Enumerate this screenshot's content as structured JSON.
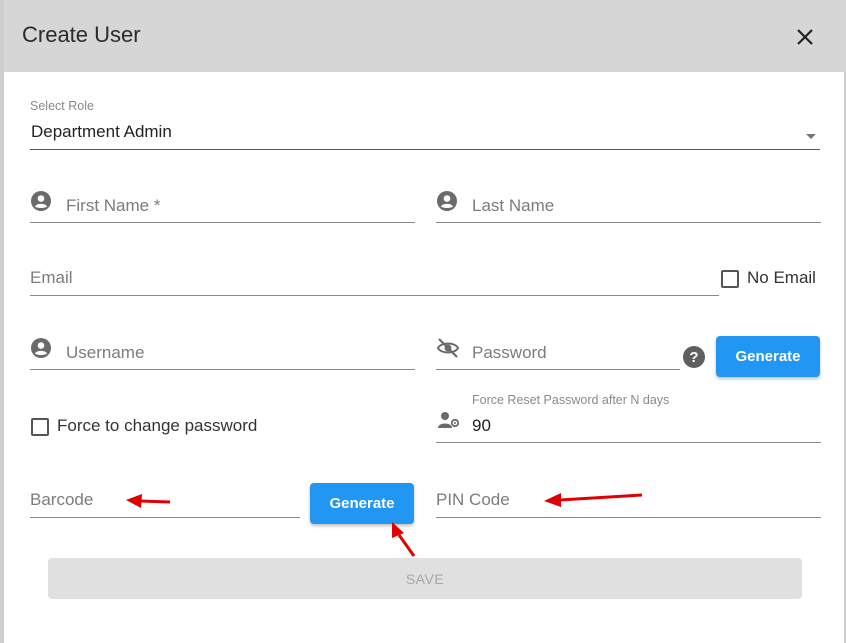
{
  "dialog": {
    "title": "Create User"
  },
  "role": {
    "label": "Select Role",
    "value": "Department Admin"
  },
  "first_name": {
    "placeholder": "First Name *"
  },
  "last_name": {
    "placeholder": "Last Name"
  },
  "email": {
    "placeholder": "Email"
  },
  "no_email": {
    "label": "No Email",
    "checked": false
  },
  "username": {
    "placeholder": "Username"
  },
  "password": {
    "placeholder": "Password"
  },
  "password_generate": {
    "label": "Generate"
  },
  "force_change": {
    "label": "Force to change password",
    "checked": false
  },
  "force_reset": {
    "label": "Force Reset Password after N days",
    "value": "90"
  },
  "barcode": {
    "placeholder": "Barcode"
  },
  "barcode_generate": {
    "label": "Generate"
  },
  "pin_code": {
    "placeholder": "PIN Code"
  },
  "save": {
    "label": "SAVE"
  },
  "colors": {
    "primary": "#2196f3",
    "header_bg": "#d6d6d6",
    "annotation_red": "#e00000"
  }
}
